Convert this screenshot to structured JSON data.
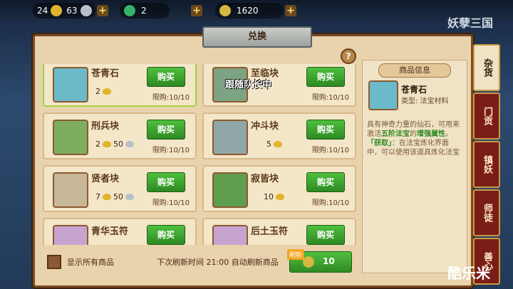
{
  "resources": {
    "gold": "24",
    "silver": "63",
    "jade": "2",
    "coins": "1620"
  },
  "title": "兑换",
  "help": "?",
  "items": [
    {
      "name": "苍青石",
      "cost_gold": "2",
      "cost_silver": "",
      "limit": "限购:10/10",
      "buy": "购买"
    },
    {
      "name": "至临块",
      "cost_gold": "",
      "cost_silver": "",
      "limit": "限购:10/10",
      "buy": "购买"
    },
    {
      "name": "刑兵块",
      "cost_gold": "2",
      "cost_silver": "50",
      "limit": "限购:10/10",
      "buy": "购买"
    },
    {
      "name": "冲斗块",
      "cost_gold": "5",
      "cost_silver": "",
      "limit": "限购:10/10",
      "buy": "购买"
    },
    {
      "name": "贤者块",
      "cost_gold": "7",
      "cost_silver": "50",
      "limit": "限购:10/10",
      "buy": "购买"
    },
    {
      "name": "寂皆块",
      "cost_gold": "10",
      "cost_silver": "",
      "limit": "限购:10/10",
      "buy": "购买"
    },
    {
      "name": "青华玉符",
      "cost_gold": "",
      "cost_silver": "",
      "limit": "",
      "buy": "购买"
    },
    {
      "name": "后土玉符",
      "cost_gold": "",
      "cost_silver": "",
      "limit": "",
      "buy": "购买"
    }
  ],
  "follow_label": "跟随队长中",
  "info": {
    "header": "商品信息",
    "name": "苍青石",
    "type": "类型: 法宝材料",
    "desc1": "具有神奇力量的仙石，可用来激活",
    "desc_hl": "五阶法宝",
    "desc2": "的",
    "desc_hl2": "增强属性",
    "desc3": "。",
    "source_label": "「获取」",
    "source": "：在法宝炼化界面中，可以使用该道具炼化法宝"
  },
  "bottom": {
    "show_all": "显示所有商品",
    "refresh": "下次刷新时间 21:00 自动刷新商品",
    "refresh_tag": "刷新",
    "refresh_cost": "10"
  },
  "tabs": [
    "杂货",
    "门贡",
    "镇妖",
    "师徒",
    "善心"
  ],
  "watermark": "酷乐米",
  "logo": "妖孽三国"
}
